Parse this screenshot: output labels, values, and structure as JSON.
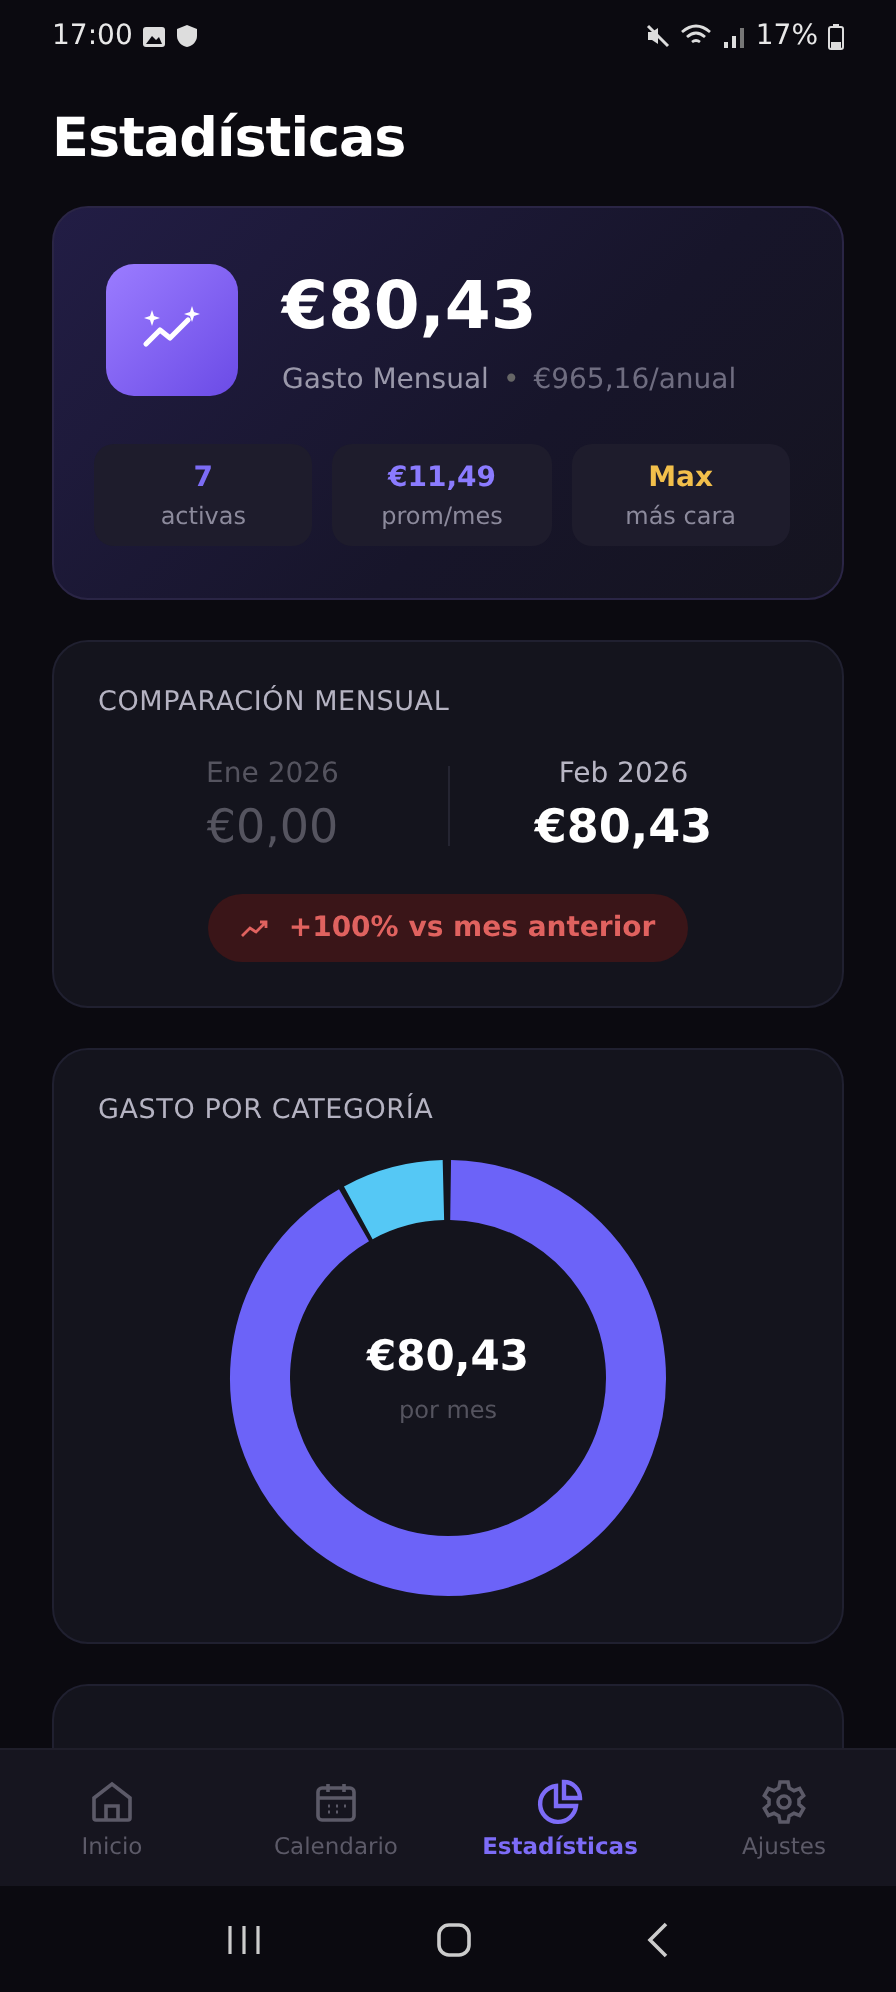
{
  "status_bar": {
    "time": "17:00",
    "battery": "17%"
  },
  "title": "Estadísticas",
  "summary": {
    "amount": "€80,43",
    "label": "Gasto Mensual",
    "separator": "•",
    "annual": "€965,16/anual",
    "stats": [
      {
        "value": "7",
        "label": "activas",
        "color": "#7c6cf5"
      },
      {
        "value": "€11,49",
        "label": "prom/mes",
        "color": "#8b7bff"
      },
      {
        "value": "Max",
        "label": "más cara",
        "color": "#f2bf4b"
      }
    ]
  },
  "comparison": {
    "heading": "COMPARACIÓN MENSUAL",
    "months": [
      {
        "label": "Ene 2026",
        "amount": "€0,00",
        "selected": false
      },
      {
        "label": "Feb 2026",
        "amount": "€80,43",
        "selected": true
      }
    ],
    "change": "+100% vs mes anterior"
  },
  "category": {
    "heading": "GASTO POR CATEGORÍA",
    "center_amount": "€80,43",
    "center_label": "por mes"
  },
  "tabs": [
    {
      "label": "Inicio",
      "kind": "home",
      "selected": false
    },
    {
      "label": "Calendario",
      "kind": "calendar",
      "selected": false
    },
    {
      "label": "Estadísticas",
      "kind": "stats",
      "selected": true
    },
    {
      "label": "Ajustes",
      "kind": "settings",
      "selected": false
    }
  ]
}
